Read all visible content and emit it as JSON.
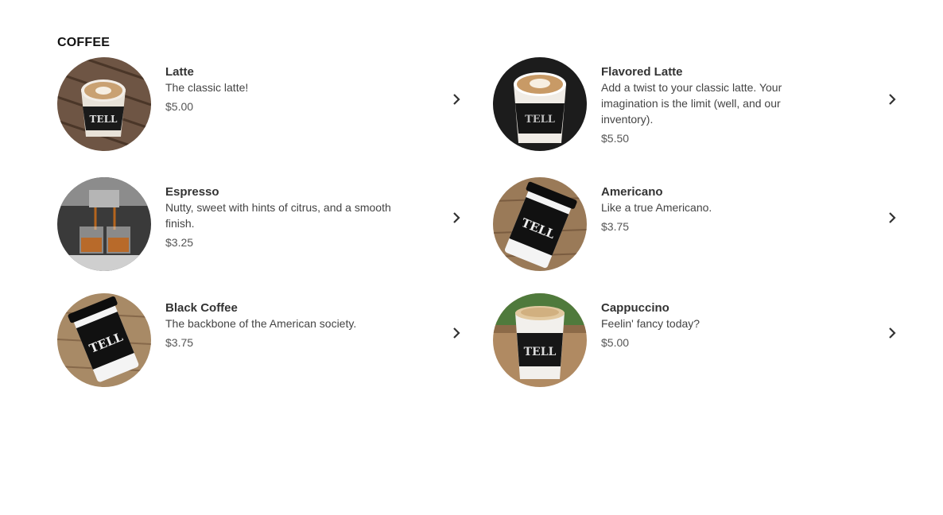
{
  "section": {
    "title": "COFFEE"
  },
  "items": [
    {
      "name": "Latte",
      "description": "The classic latte!",
      "price": "$5.00",
      "image": "latte-cup"
    },
    {
      "name": "Flavored Latte",
      "description": "Add a twist to your classic latte. Your imagination is the limit (well, and our inventory).",
      "price": "$5.50",
      "image": "flavored-latte-cup"
    },
    {
      "name": "Espresso",
      "description": "Nutty, sweet with hints of citrus, and a smooth finish.",
      "price": "$3.25",
      "image": "espresso-shots"
    },
    {
      "name": "Americano",
      "description": "Like a true Americano.",
      "price": "$3.75",
      "image": "americano-cup"
    },
    {
      "name": "Black Coffee",
      "description": "The backbone of the American society.",
      "price": "$3.75",
      "image": "black-coffee-cup"
    },
    {
      "name": "Cappuccino",
      "description": "Feelin' fancy today?",
      "price": "$5.00",
      "image": "cappuccino-cup"
    }
  ],
  "icons": {
    "item_arrow": "chevron-right-icon"
  },
  "colors": {
    "text": "#333333",
    "title": "#111111",
    "cup_band": "#1a1a1a",
    "wood": "#8a6a4a"
  }
}
